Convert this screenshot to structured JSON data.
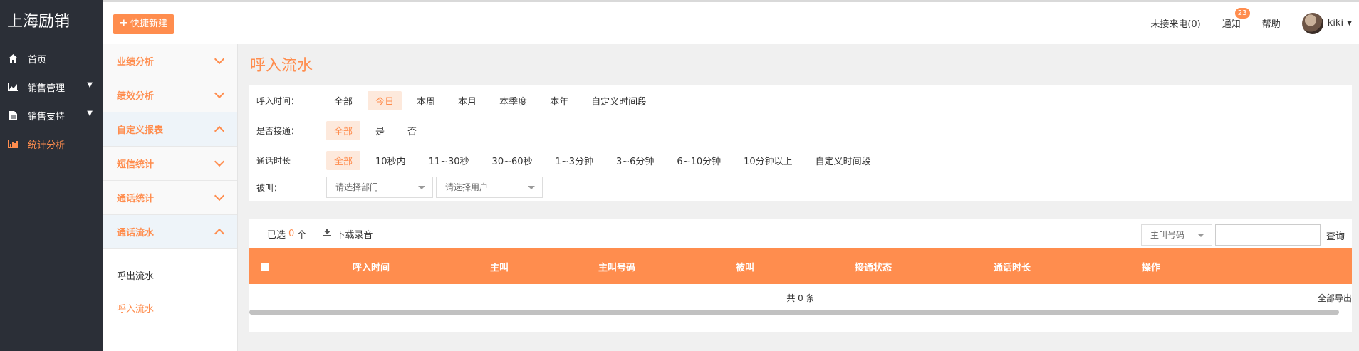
{
  "brand": "上海励销",
  "nav": [
    {
      "label": "首页",
      "icon": "home-icon",
      "chevron": false,
      "active": false
    },
    {
      "label": "销售管理",
      "icon": "chart-area-icon",
      "chevron": true,
      "active": false
    },
    {
      "label": "销售支持",
      "icon": "document-icon",
      "chevron": true,
      "active": false
    },
    {
      "label": "统计分析",
      "icon": "bar-chart-icon",
      "chevron": false,
      "active": true
    }
  ],
  "topbar": {
    "quick_create": "✚ 快捷新建",
    "missed_calls": "未接来电(0)",
    "notice": "通知",
    "notice_count": "23",
    "help": "帮助",
    "user": "kiki"
  },
  "submenu": {
    "items": [
      {
        "label": "业绩分析",
        "open": false
      },
      {
        "label": "绩效分析",
        "open": false
      },
      {
        "label": "自定义报表",
        "open": true
      },
      {
        "label": "短信统计",
        "open": false
      },
      {
        "label": "通话统计",
        "open": false
      },
      {
        "label": "通话流水",
        "open": true
      }
    ],
    "links": [
      {
        "label": "呼出流水",
        "active": false
      },
      {
        "label": "呼入流水",
        "active": true
      }
    ]
  },
  "page": {
    "title": "呼入流水"
  },
  "filters": {
    "time": {
      "label": "呼入时间：",
      "options": [
        "全部",
        "今日",
        "本周",
        "本月",
        "本季度",
        "本年",
        "自定义时间段"
      ],
      "selected": 1
    },
    "connected": {
      "label": "是否接通：",
      "options": [
        "全部",
        "是",
        "否"
      ],
      "selected": 0
    },
    "duration": {
      "label": "通话时长",
      "options": [
        "全部",
        "10秒内",
        "11~30秒",
        "30~60秒",
        "1~3分钟",
        "3~6分钟",
        "6~10分钟",
        "10分钟以上",
        "自定义时间段"
      ],
      "selected": 0
    },
    "callee": {
      "label": "被叫：",
      "dept_placeholder": "请选择部门",
      "user_placeholder": "请选择用户"
    }
  },
  "list": {
    "selected_prefix": "已选",
    "selected_count": "0",
    "selected_suffix": "个",
    "download": "下载录音",
    "search_field": "主叫号码",
    "query": "查询",
    "columns": [
      "呼入时间",
      "主叫",
      "主叫号码",
      "被叫",
      "接通状态",
      "通话时长",
      "操作"
    ],
    "empty_text": "共 0 条",
    "export": "全部导出"
  },
  "colors": {
    "accent": "#ff8d4e",
    "sidebar": "#2b2f37"
  }
}
